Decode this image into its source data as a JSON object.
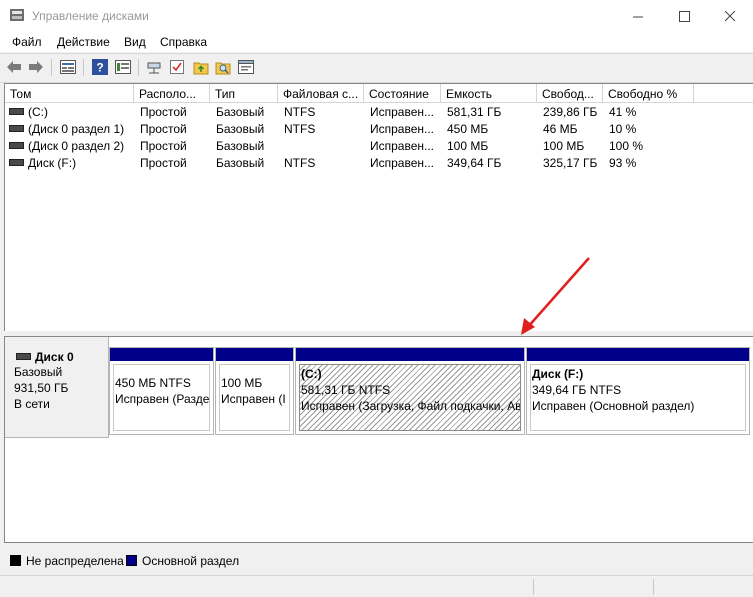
{
  "window": {
    "title": "Управление дисками"
  },
  "menu": [
    "Файл",
    "Действие",
    "Вид",
    "Справка"
  ],
  "toolbar_icons": [
    "back-arrow-icon",
    "forward-arrow-icon",
    "disk-list-icon",
    "help-icon",
    "properties-icon",
    "connect-icon",
    "check-icon",
    "folder-up-icon",
    "search-folder-icon",
    "view-icon"
  ],
  "volume_table": {
    "columns": [
      "Том",
      "Располо...",
      "Тип",
      "Файловая с...",
      "Состояние",
      "Емкость",
      "Свобод...",
      "Свободно %"
    ],
    "rows": [
      [
        "(C:)",
        "Простой",
        "Базовый",
        "NTFS",
        "Исправен...",
        "581,31 ГБ",
        "239,86 ГБ",
        "41 %"
      ],
      [
        "(Диск 0 раздел 1)",
        "Простой",
        "Базовый",
        "NTFS",
        "Исправен...",
        "450 МБ",
        "46 МБ",
        "10 %"
      ],
      [
        "(Диск 0 раздел 2)",
        "Простой",
        "Базовый",
        "",
        "Исправен...",
        "100 МБ",
        "100 МБ",
        "100 %"
      ],
      [
        "Диск (F:)",
        "Простой",
        "Базовый",
        "NTFS",
        "Исправен...",
        "349,64 ГБ",
        "325,17 ГБ",
        "93 %"
      ]
    ]
  },
  "disk": {
    "name": "Диск 0",
    "type": "Базовый",
    "size": "931,50 ГБ",
    "status": "В сети",
    "partitions": [
      {
        "title": "",
        "size": "450 МБ NTFS",
        "status": "Исправен (Разде"
      },
      {
        "title": "",
        "size": "100 МБ",
        "status": "Исправен (I"
      },
      {
        "title": "(C:)",
        "size": "581,31 ГБ NTFS",
        "status": "Исправен (Загрузка, Файл подкачки, Ав"
      },
      {
        "title": "Диск  (F:)",
        "size": "349,64 ГБ NTFS",
        "status": "Исправен (Основной раздел)"
      }
    ]
  },
  "legend": [
    {
      "label": "Не распределена",
      "color": "#000000"
    },
    {
      "label": "Основной раздел",
      "color": "#00008b"
    }
  ],
  "annotation": {
    "color": "#e0201e"
  }
}
